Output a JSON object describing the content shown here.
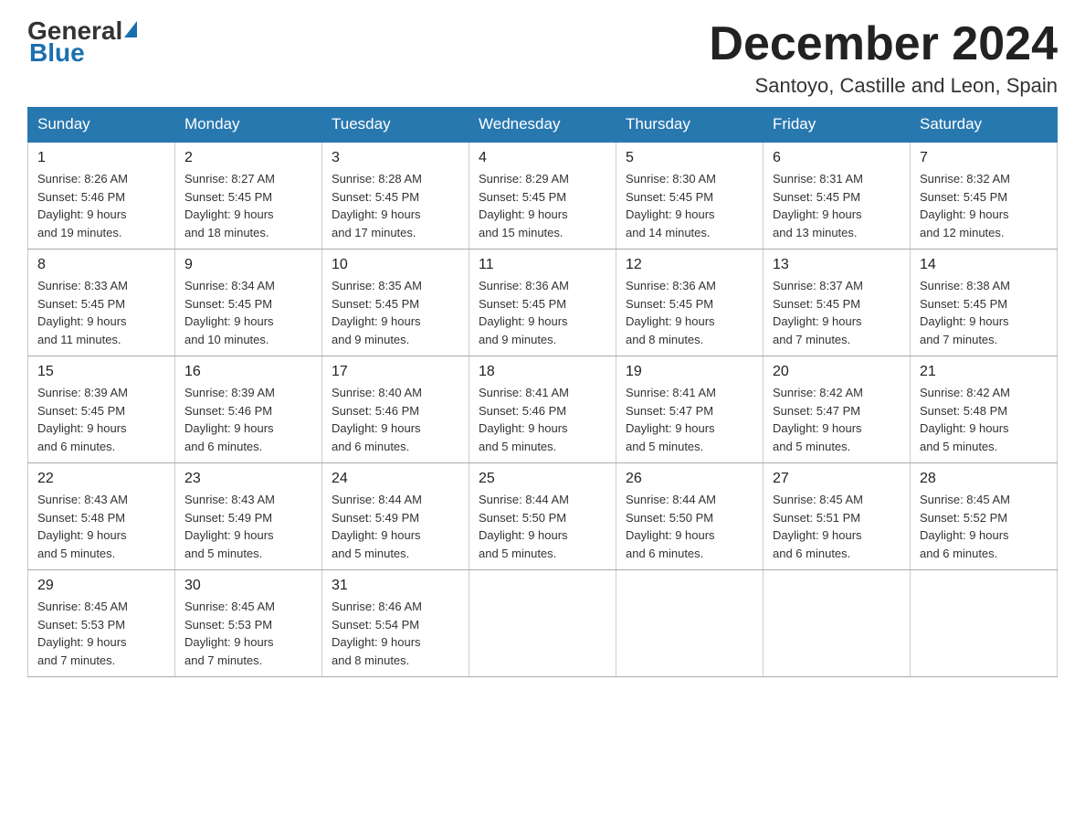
{
  "logo": {
    "general": "General",
    "blue": "Blue"
  },
  "header": {
    "month_year": "December 2024",
    "location": "Santoyo, Castille and Leon, Spain"
  },
  "days_of_week": [
    "Sunday",
    "Monday",
    "Tuesday",
    "Wednesday",
    "Thursday",
    "Friday",
    "Saturday"
  ],
  "weeks": [
    [
      {
        "day": "1",
        "sunrise": "8:26 AM",
        "sunset": "5:46 PM",
        "daylight": "9 hours and 19 minutes."
      },
      {
        "day": "2",
        "sunrise": "8:27 AM",
        "sunset": "5:45 PM",
        "daylight": "9 hours and 18 minutes."
      },
      {
        "day": "3",
        "sunrise": "8:28 AM",
        "sunset": "5:45 PM",
        "daylight": "9 hours and 17 minutes."
      },
      {
        "day": "4",
        "sunrise": "8:29 AM",
        "sunset": "5:45 PM",
        "daylight": "9 hours and 15 minutes."
      },
      {
        "day": "5",
        "sunrise": "8:30 AM",
        "sunset": "5:45 PM",
        "daylight": "9 hours and 14 minutes."
      },
      {
        "day": "6",
        "sunrise": "8:31 AM",
        "sunset": "5:45 PM",
        "daylight": "9 hours and 13 minutes."
      },
      {
        "day": "7",
        "sunrise": "8:32 AM",
        "sunset": "5:45 PM",
        "daylight": "9 hours and 12 minutes."
      }
    ],
    [
      {
        "day": "8",
        "sunrise": "8:33 AM",
        "sunset": "5:45 PM",
        "daylight": "9 hours and 11 minutes."
      },
      {
        "day": "9",
        "sunrise": "8:34 AM",
        "sunset": "5:45 PM",
        "daylight": "9 hours and 10 minutes."
      },
      {
        "day": "10",
        "sunrise": "8:35 AM",
        "sunset": "5:45 PM",
        "daylight": "9 hours and 9 minutes."
      },
      {
        "day": "11",
        "sunrise": "8:36 AM",
        "sunset": "5:45 PM",
        "daylight": "9 hours and 9 minutes."
      },
      {
        "day": "12",
        "sunrise": "8:36 AM",
        "sunset": "5:45 PM",
        "daylight": "9 hours and 8 minutes."
      },
      {
        "day": "13",
        "sunrise": "8:37 AM",
        "sunset": "5:45 PM",
        "daylight": "9 hours and 7 minutes."
      },
      {
        "day": "14",
        "sunrise": "8:38 AM",
        "sunset": "5:45 PM",
        "daylight": "9 hours and 7 minutes."
      }
    ],
    [
      {
        "day": "15",
        "sunrise": "8:39 AM",
        "sunset": "5:45 PM",
        "daylight": "9 hours and 6 minutes."
      },
      {
        "day": "16",
        "sunrise": "8:39 AM",
        "sunset": "5:46 PM",
        "daylight": "9 hours and 6 minutes."
      },
      {
        "day": "17",
        "sunrise": "8:40 AM",
        "sunset": "5:46 PM",
        "daylight": "9 hours and 6 minutes."
      },
      {
        "day": "18",
        "sunrise": "8:41 AM",
        "sunset": "5:46 PM",
        "daylight": "9 hours and 5 minutes."
      },
      {
        "day": "19",
        "sunrise": "8:41 AM",
        "sunset": "5:47 PM",
        "daylight": "9 hours and 5 minutes."
      },
      {
        "day": "20",
        "sunrise": "8:42 AM",
        "sunset": "5:47 PM",
        "daylight": "9 hours and 5 minutes."
      },
      {
        "day": "21",
        "sunrise": "8:42 AM",
        "sunset": "5:48 PM",
        "daylight": "9 hours and 5 minutes."
      }
    ],
    [
      {
        "day": "22",
        "sunrise": "8:43 AM",
        "sunset": "5:48 PM",
        "daylight": "9 hours and 5 minutes."
      },
      {
        "day": "23",
        "sunrise": "8:43 AM",
        "sunset": "5:49 PM",
        "daylight": "9 hours and 5 minutes."
      },
      {
        "day": "24",
        "sunrise": "8:44 AM",
        "sunset": "5:49 PM",
        "daylight": "9 hours and 5 minutes."
      },
      {
        "day": "25",
        "sunrise": "8:44 AM",
        "sunset": "5:50 PM",
        "daylight": "9 hours and 5 minutes."
      },
      {
        "day": "26",
        "sunrise": "8:44 AM",
        "sunset": "5:50 PM",
        "daylight": "9 hours and 6 minutes."
      },
      {
        "day": "27",
        "sunrise": "8:45 AM",
        "sunset": "5:51 PM",
        "daylight": "9 hours and 6 minutes."
      },
      {
        "day": "28",
        "sunrise": "8:45 AM",
        "sunset": "5:52 PM",
        "daylight": "9 hours and 6 minutes."
      }
    ],
    [
      {
        "day": "29",
        "sunrise": "8:45 AM",
        "sunset": "5:53 PM",
        "daylight": "9 hours and 7 minutes."
      },
      {
        "day": "30",
        "sunrise": "8:45 AM",
        "sunset": "5:53 PM",
        "daylight": "9 hours and 7 minutes."
      },
      {
        "day": "31",
        "sunrise": "8:46 AM",
        "sunset": "5:54 PM",
        "daylight": "9 hours and 8 minutes."
      },
      null,
      null,
      null,
      null
    ]
  ],
  "labels": {
    "sunrise": "Sunrise:",
    "sunset": "Sunset:",
    "daylight": "Daylight:"
  }
}
